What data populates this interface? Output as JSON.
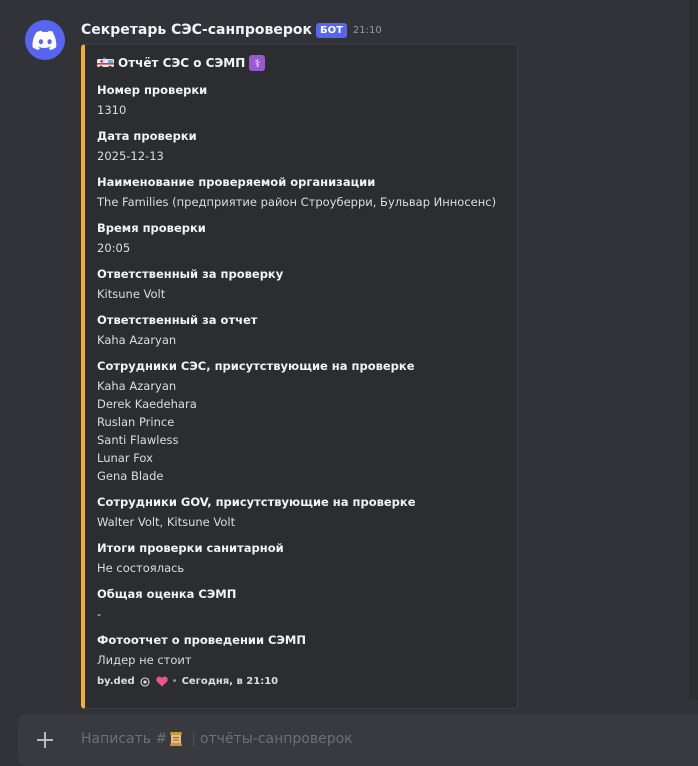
{
  "message": {
    "author": "Секретарь СЭС-санпроверок",
    "badge": "БОТ",
    "time": "21:10"
  },
  "embed": {
    "title": "Отчёт СЭС о СЭМП",
    "accent_color": "#f0b232",
    "fields": [
      {
        "name": "Номер проверки",
        "value": "1310"
      },
      {
        "name": "Дата проверки",
        "value": "2025-12-13"
      },
      {
        "name": "Наименование проверяемой организации",
        "value": "The Families (предприятие район Строуберри, Бульвар Инносенс)"
      },
      {
        "name": "Время проверки",
        "value": "20:05"
      },
      {
        "name": "Ответственный за проверку",
        "value": "Kitsune Volt"
      },
      {
        "name": "Ответственный за отчет",
        "value": "Kaha Azaryan"
      },
      {
        "name": "Сотрудники СЭС, присутствующие на проверке",
        "values": [
          "Kaha Azaryan",
          "Derek Kaedehara",
          "Ruslan Prince",
          "Santi Flawless",
          "Lunar Fox",
          "Gena Blade"
        ]
      },
      {
        "name": "Сотрудники GOV, присутствующие на проверке",
        "value": "Walter Volt, Kitsune Volt"
      },
      {
        "name": "Итоги проверки санитарной",
        "value": "Не состоялась"
      },
      {
        "name": "Общая оценка СЭМП",
        "value": "-"
      },
      {
        "name": "Фотоотчет о проведении СЭМП",
        "value": "Лидер не стоит"
      }
    ],
    "footer": {
      "author": "by.ded",
      "separator": "•",
      "time": "Сегодня, в 21:10"
    }
  },
  "composer": {
    "placeholder_prefix": "Написать #",
    "divider": "|",
    "channel": "отчёты-санпроверок"
  }
}
